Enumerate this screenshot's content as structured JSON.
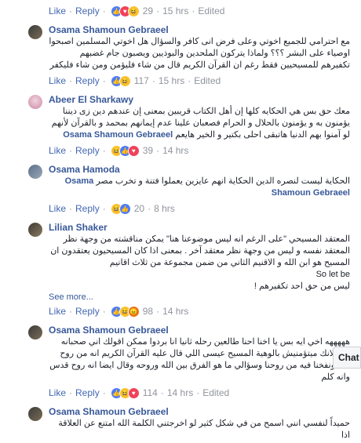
{
  "labels": {
    "like": "Like",
    "reply": "Reply",
    "edited": "Edited",
    "see_more": "See more...",
    "chat": "Chat"
  },
  "top_actions": {
    "count": "29",
    "time": "15 hrs"
  },
  "comments": [
    {
      "author": "Osama Shamoun Gebraeel",
      "text": "مع احترامي للجميع اخوتي وعلى فرض انى كافر والسؤال هل اخوتي المسلمين اصبحوا اوصياء على البشر ؟؟؟ ولماذا يتركون الملحدين والبوذيين ويصبون جام غضبهم تكفيرهم للمسيحيين فقط رغم ان القرآن الكريم قال من شاء فليؤمن ومن شاء فليكفر",
      "count": "117",
      "time": "15 hrs"
    },
    {
      "author": "Abeer El Sharkawy",
      "text": "معك حق بس هي الحكايه كلها إن أهل الكتاب قريبين بمعنى إن عندهم دين زى ديننا يؤمنون به و يؤمنون بالحلال و الحرام فصعبان علينا عدم إيمانهم بمحمد و بالقرآن لأنهم لو آمنوا بهم الدنيا هاتبقى احلى بكتير و الخير هايعم",
      "tag": "Osama Shamoun Gebraeel",
      "count": "39",
      "time": "14 hrs"
    },
    {
      "author": "Osama Hamoda",
      "text": "الحكاية ليست لنصره الدين الحكاية انهم عايزين يعملوا فتنة و تخرب مصر",
      "tag": "Osama Shamoun Gebraeel",
      "count": "20",
      "time": "8 hrs"
    },
    {
      "author": "Lilian Shaker",
      "text": "المعتقد المسيحي \"على الرغم انه ليس موضوعنا هنا\" يمكن مناقشته من وجهة نظر المعتقد نفسه و ليس من وجهة نظر معتقد آخر . بمعنى اذا كان المسيحيون يعتقدون ان المسيح هو ابن الله و الاقنيم الثاني من ضمن مجموعة من ثلاث اقانيم",
      "extra": "So let be",
      "text2": "ليس من حق احد تكفيرهم !",
      "count": "98",
      "time": "14 hrs"
    },
    {
      "author": "Osama Shamoun Gebraeel",
      "text": "هههههه اخي ايه بس يا اخنا احنا طالعين رحله ثانيا انا بردوا ممكن اقولك اني صحبانه عليا لانك ميتؤمنيش بالوهية المسيح عيسى اللي قال عليه القرآن الكريم انه من روح الله ونفخنا فيه من روحنا وسؤالي ما هو الفرق بين الله وروحه وقال ايضا انه روح قدس وانه كلم",
      "count": "114",
      "time": "14 hrs"
    },
    {
      "author": "Osama Shamoun Gebraeel",
      "text": "حميداً لنفسي انني اسمح من في شكل كثير لو اخرجتني الكلمة الله امتنع عن العلاقة اذا",
      "time": ""
    }
  ]
}
